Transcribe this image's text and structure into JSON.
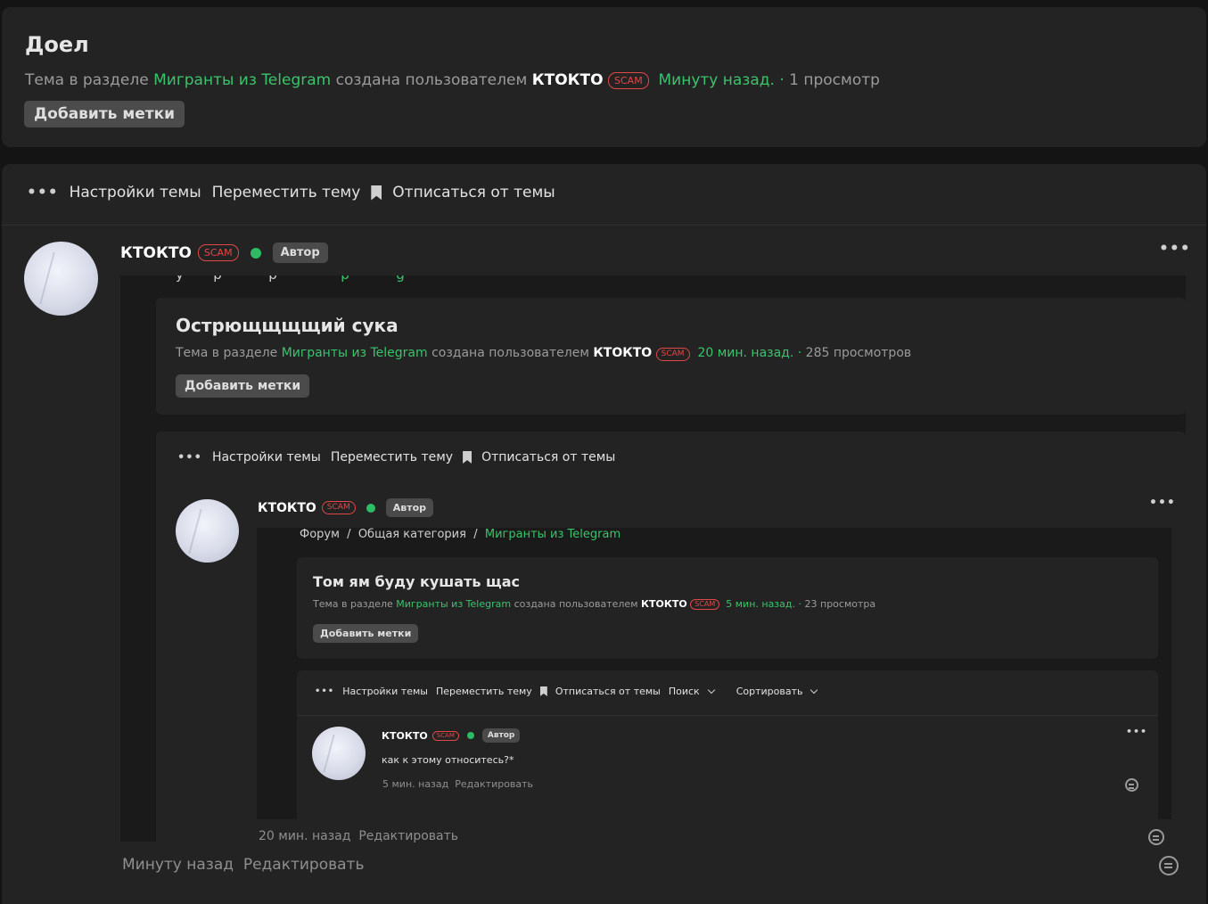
{
  "colors": {
    "accent_green": "#39c46b",
    "scam_red": "#e04848",
    "online_green": "#2dbb63"
  },
  "levels": [
    {
      "title": "Доел",
      "meta_prefix": "Тема в разделе",
      "section": "Мигранты из Telegram",
      "meta_mid": "создана пользователем",
      "user": "КТОКТО",
      "badge": "SCAM",
      "time": "Минуту назад.",
      "views": "1 просмотр",
      "tag_button": "Добавить метки",
      "toolbar": {
        "settings": "Настройки темы",
        "move": "Переместить тему",
        "unsubscribe": "Отписаться от темы"
      },
      "post": {
        "author": "КТОКТО",
        "badge": "SCAM",
        "role": "Автор",
        "time": "Минуту назад",
        "edit": "Редактировать"
      }
    },
    {
      "title": "Острющщщщий сука",
      "meta_prefix": "Тема в разделе",
      "section": "Мигранты из Telegram",
      "meta_mid": "создана пользователем",
      "user": "КТОКТО",
      "badge": "SCAM",
      "time": "20 мин. назад.",
      "views": "285 просмотров",
      "tag_button": "Добавить метки",
      "toolbar": {
        "settings": "Настройки темы",
        "move": "Переместить тему",
        "unsubscribe": "Отписаться от темы"
      },
      "post": {
        "author": "КТОКТО",
        "badge": "SCAM",
        "role": "Автор",
        "time": "20 мин. назад",
        "edit": "Редактировать"
      },
      "breadcrumb": {
        "forum": "Форум",
        "category": "Общая категория",
        "section": "Мигранты из Telegram",
        "sep": "/"
      }
    },
    {
      "title": "Том ям буду кушать щас",
      "meta_prefix": "Тема в разделе",
      "section": "Мигранты из Telegram",
      "meta_mid": "создана пользователем",
      "user": "КТОКТО",
      "badge": "SCAM",
      "time": "5 мин. назад.",
      "views": "23 просмотра",
      "tag_button": "Добавить метки",
      "toolbar": {
        "settings": "Настройки темы",
        "move": "Переместить тему",
        "unsubscribe": "Отписаться от темы",
        "search": "Поиск",
        "sort": "Сортировать"
      },
      "post": {
        "author": "КТОКТО",
        "badge": "SCAM",
        "role": "Автор",
        "body": "как к этому относитесь?*",
        "time": "5 мин. назад",
        "edit": "Редактировать"
      }
    }
  ]
}
